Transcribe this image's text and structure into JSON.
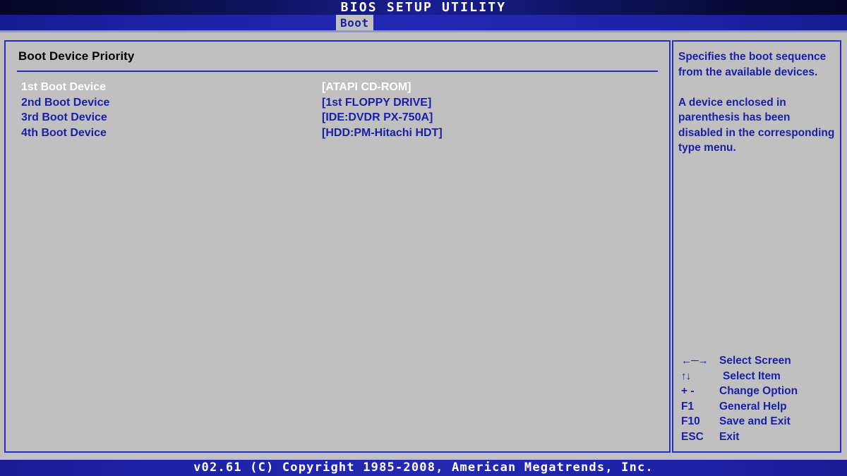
{
  "window": {
    "title": "BIOS SETUP UTILITY"
  },
  "tabs": [
    {
      "id": "boot",
      "label": "Boot",
      "active": true
    }
  ],
  "main": {
    "section_title": "Boot Device Priority",
    "rows": [
      {
        "label": "1st Boot Device",
        "value": "[ATAPI CD-ROM]",
        "selected": true
      },
      {
        "label": "2nd Boot Device",
        "value": "[1st FLOPPY DRIVE]",
        "selected": false
      },
      {
        "label": "3rd Boot Device",
        "value": "[IDE:DVDR PX-750A]",
        "selected": false
      },
      {
        "label": "4th Boot Device",
        "value": "[HDD:PM-Hitachi HDT]",
        "selected": false
      }
    ]
  },
  "help": {
    "paragraph_1": "Specifies the boot sequence from the available devices.",
    "paragraph_2": "A device enclosed in parenthesis has been disabled in the corresponding type menu."
  },
  "key_legend": [
    {
      "key": "←─→",
      "desc": "Select Screen",
      "icon": "left-right-arrow-icon"
    },
    {
      "key": "↑↓",
      "desc": "Select Item",
      "icon": "up-down-arrow-icon"
    },
    {
      "key": "+ -",
      "desc": "Change Option",
      "icon": "plus-minus-icon"
    },
    {
      "key": "F1",
      "desc": "General Help",
      "icon": "f1-key-icon"
    },
    {
      "key": "F10",
      "desc": "Save and Exit",
      "icon": "f10-key-icon"
    },
    {
      "key": "ESC",
      "desc": "Exit",
      "icon": "esc-key-icon"
    }
  ],
  "footer": {
    "copyright": "v02.61 (C) Copyright 1985-2008, American Megatrends, Inc."
  },
  "colors": {
    "background": "#c0c0c0",
    "accent_blue": "#1a1fa5",
    "border_blue": "#2a2ec0",
    "title_dark": "#04072a",
    "selected_text": "#ffffff",
    "section_title_text": "#000000"
  }
}
